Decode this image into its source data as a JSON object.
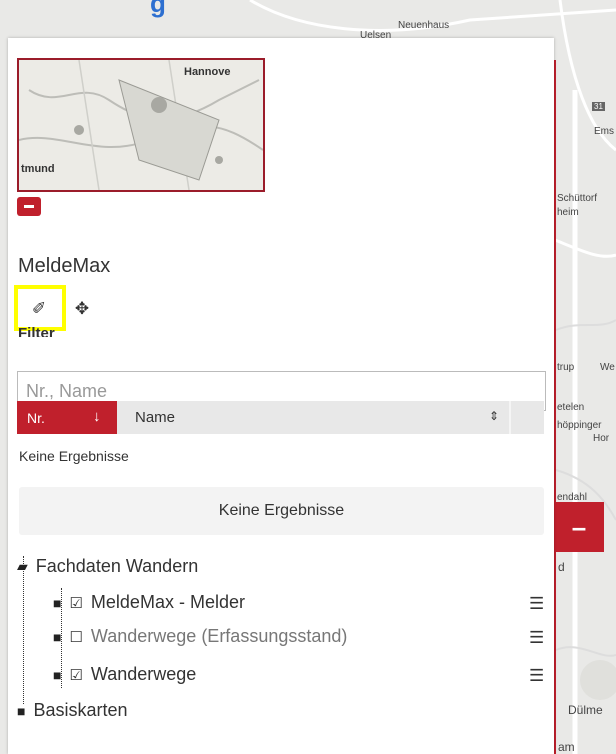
{
  "page_title_fragment": "g",
  "map": {
    "labels": {
      "neuenhaus": "Neuenhaus",
      "uelsen": "Uelsen",
      "ems": "Ems",
      "schuttorf": "Schüttorf",
      "heim": "heim",
      "trup": "trup",
      "we": "We",
      "etelen": "etelen",
      "hopping": "höppinger",
      "hor": "Hor",
      "endahl": "endahl",
      "d": "d",
      "dulme": "Dülme",
      "am": "am",
      "road_number": "31"
    },
    "collapse_tab_label": "–"
  },
  "overview": {
    "city_top": "Hannove",
    "city_bottom": "tmund"
  },
  "app": {
    "title": "MeldeMax",
    "tools": {
      "draw_icon": "✐",
      "move_icon": "✥"
    }
  },
  "filter": {
    "label": "Filter",
    "placeholder": "Nr., Name",
    "value": ""
  },
  "table": {
    "col_nr": "Nr.",
    "col_nr_sort": "↓",
    "col_name": "Name",
    "col_name_sort": "⇕",
    "no_results_text": "Keine Ergebnisse",
    "no_results_button": "Keine Ergebnisse"
  },
  "layers": {
    "group": {
      "label": "Fachdaten Wandern"
    },
    "items": [
      {
        "label": "MeldeMax - Melder",
        "checked": true
      },
      {
        "label": "Wanderwege (Erfassungsstand)",
        "checked": false
      },
      {
        "label": "Wanderwege",
        "checked": true
      }
    ],
    "base": {
      "label": "Basiskarten"
    }
  },
  "colors": {
    "accent": "#c0202c",
    "highlight": "#ffff00",
    "title_blue": "#2d6fd0"
  }
}
